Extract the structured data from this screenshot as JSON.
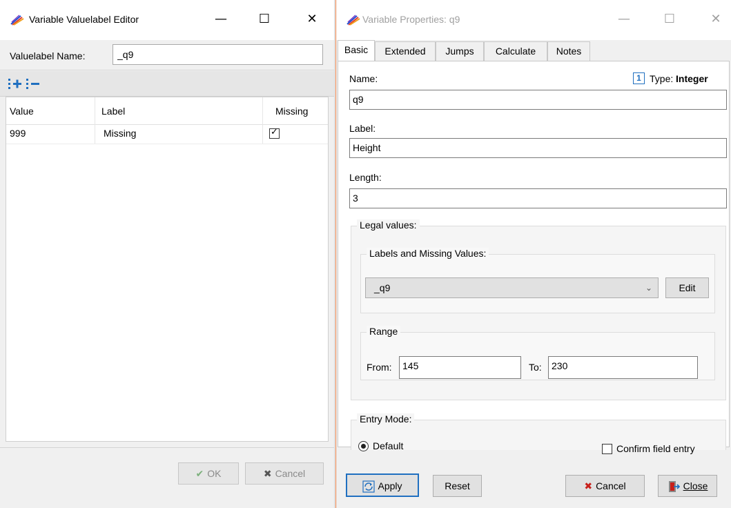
{
  "valuelabel_editor": {
    "title": "Variable Valuelabel Editor",
    "window_controls": {
      "minimize": "—",
      "maximize": "☐",
      "close": "✕"
    },
    "name_label": "Valuelabel Name:",
    "name_value": "_q9",
    "toolbar": {
      "add_icon": "add-row-icon",
      "remove_icon": "remove-row-icon"
    },
    "columns": [
      "Value",
      "Label",
      "Missing"
    ],
    "rows": [
      {
        "value": "999",
        "label": "Missing",
        "missing": true
      }
    ],
    "ok_label": "OK",
    "cancel_label": "Cancel"
  },
  "properties": {
    "title": "Variable Properties: q9",
    "window_controls": {
      "minimize": "—",
      "maximize": "☐",
      "close": "✕"
    },
    "tabs": [
      "Basic",
      "Extended",
      "Jumps",
      "Calculate",
      "Notes"
    ],
    "active_tab": "Basic",
    "name_label": "Name:",
    "type_badge": "1",
    "type_label": "Type:",
    "type_value": "Integer",
    "name_value": "q9",
    "label_label": "Label:",
    "label_value": "Height",
    "length_label": "Length:",
    "length_value": "3",
    "legal_values_legend": "Legal values:",
    "labels_missing_legend": "Labels and Missing Values:",
    "valuelabel_selected": "_q9",
    "edit_label": "Edit",
    "range_legend": "Range",
    "from_label": "From:",
    "from_value": "145",
    "to_label": "To:",
    "to_value": "230",
    "entry_mode_legend": "Entry Mode:",
    "default_radio_label": "Default",
    "confirm_label": "Confirm field entry",
    "apply_label": "Apply",
    "reset_label": "Reset",
    "cancel_label": "Cancel",
    "close_label": "Close"
  },
  "colors": {
    "accent_blue": "#1f6fc0",
    "cancel_red": "#c8201b",
    "ok_green": "#3c9a3c",
    "app_border": "#e0763c"
  }
}
